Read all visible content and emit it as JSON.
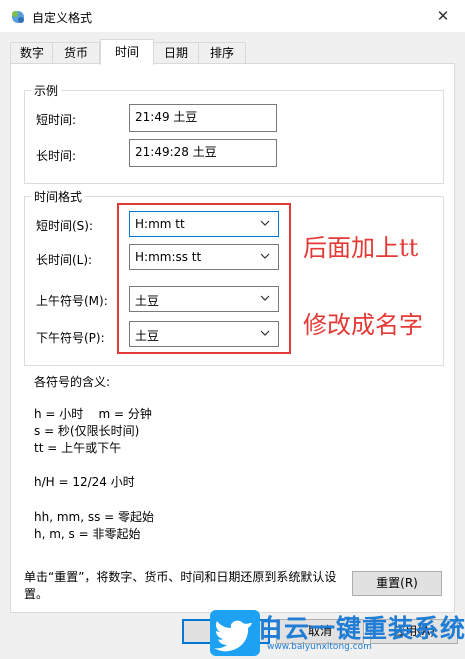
{
  "window": {
    "title": "自定义格式"
  },
  "tabs": [
    {
      "label": "数字"
    },
    {
      "label": "货币"
    },
    {
      "label": "时间"
    },
    {
      "label": "日期"
    },
    {
      "label": "排序"
    }
  ],
  "example": {
    "group_title": "示例",
    "short_label": "短时间:",
    "short_value": "21:49 土豆",
    "long_label": "长时间:",
    "long_value": "21:49:28 土豆"
  },
  "format": {
    "group_title": "时间格式",
    "short_label": "短时间(S):",
    "short_value": "H:mm tt",
    "long_label": "长时间(L):",
    "long_value": "H:mm:ss tt",
    "am_label": "上午符号(M):",
    "am_value": "土豆",
    "pm_label": "下午符号(P):",
    "pm_value": "土豆"
  },
  "annotations": {
    "add_tt": "后面加上tt",
    "rename": "修改成名字"
  },
  "meanings": {
    "title": "各符号的含义:",
    "line1": "h = 小时    m = 分钟",
    "line2": "s = 秒(仅限长时间)",
    "line3": "tt = 上午或下午",
    "line4": "h/H = 12/24 小时",
    "line5": "hh, mm, ss = 零起始",
    "line6": "h, m, s = 非零起始"
  },
  "reset": {
    "note": "单击“重置”，将数字、货币、时间和日期还原到系统默认设置。",
    "button_label": "重置(R)"
  },
  "footer": {
    "ok_label": "",
    "cancel_label": "取消",
    "apply_label": "应用(A)"
  },
  "watermark": {
    "text": "白云一键重装系统",
    "url": "www.baiyunxitong.com"
  },
  "colors": {
    "highlight": "#e53935",
    "focus": "#0078d7",
    "watermark": "#1f7dd6"
  }
}
